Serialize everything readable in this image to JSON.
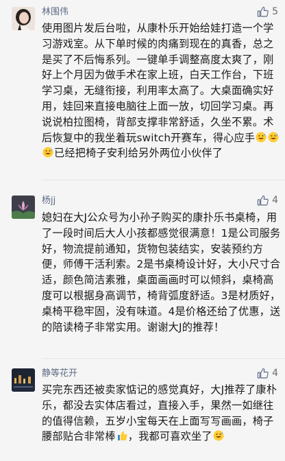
{
  "comments": [
    {
      "user": "林围伟",
      "likes": "5",
      "avatar_icon": "woman-photo-avatar",
      "text": "使用图片发后台啦，从康朴乐开始给娃打造一个学习游戏室。从下单时候的肉痛到现在的真香，总之是买了不后悔系列。一键单手调整高度太爽了，刚好上个月因为做手术在家上班，白天工作台，下班学习桌，无缝衔接，利用率太高了。大桌面确实好用，娃回来直接电脑往上面一放，切回学习桌。再说说柏拉图椅，背部支撑非常舒适，久坐不累。术后恢复中的我坐着玩switch开赛车，得心应手",
      "text_tail": "已经把椅子安利给另外两位小伙伴了",
      "emojis": [
        "grin-sweat-emoji",
        "grin-sweat-emoji",
        "grin-sweat-emoji"
      ]
    },
    {
      "user": "杨jj",
      "likes": "4",
      "avatar_icon": "lotus-flower-avatar",
      "text": "媳妇在大J公众号为小孙子购买的康扑乐书桌椅，用了一段时间后大人小孩都感觉很满意！1是公司服务好，物流提前通知，货物包装结实，安装预约方便，师傅干活利索。2是书桌椅设计好，大小尺寸合适，颜色简洁素雅，桌面画画时可以倾斜，桌椅高度可以根据身高调节，椅背弧度舒适。3是材质好，桌椅平稳牢固，没有味道。4是价格还给了优惠，送的陪读椅子非常实用。谢谢大J的推荐！"
    },
    {
      "user": "静等花开",
      "likes": "4",
      "avatar_icon": "night-city-avatar",
      "text": "买完东西还被卖家惦记的感觉真好，大J推荐了康朴乐，都没去实体店看过，直接入手，果然一如继往的值得信赖，五岁小宝每天在上面写写画画，椅子腰部贴合非常棒",
      "text_mid": "，我都可喜欢坐了",
      "emojis": [
        "thumbs-up-emoji",
        "grin-sweat-emoji"
      ]
    }
  ],
  "colors": {
    "name": "#5d6a84",
    "text": "#1a1a1a",
    "bg": "#f5f5f5"
  }
}
